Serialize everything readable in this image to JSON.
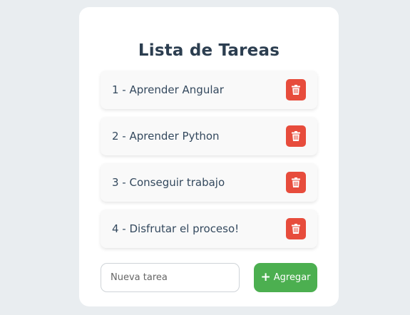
{
  "title": "Lista de Tareas",
  "tasks": [
    {
      "label": "1 - Aprender Angular"
    },
    {
      "label": "2 - Aprender Python"
    },
    {
      "label": "3 - Conseguir trabajo"
    },
    {
      "label": "4 - Disfrutar el proceso!"
    }
  ],
  "input": {
    "placeholder": "Nueva tarea",
    "value": ""
  },
  "add_button": {
    "icon": "+",
    "label": "Agregar"
  },
  "colors": {
    "delete": "#e74c3c",
    "add": "#4caf50",
    "title": "#2c3e50",
    "background": "#e9edf0"
  },
  "icons": {
    "delete": "trash-icon",
    "add": "plus-icon"
  }
}
